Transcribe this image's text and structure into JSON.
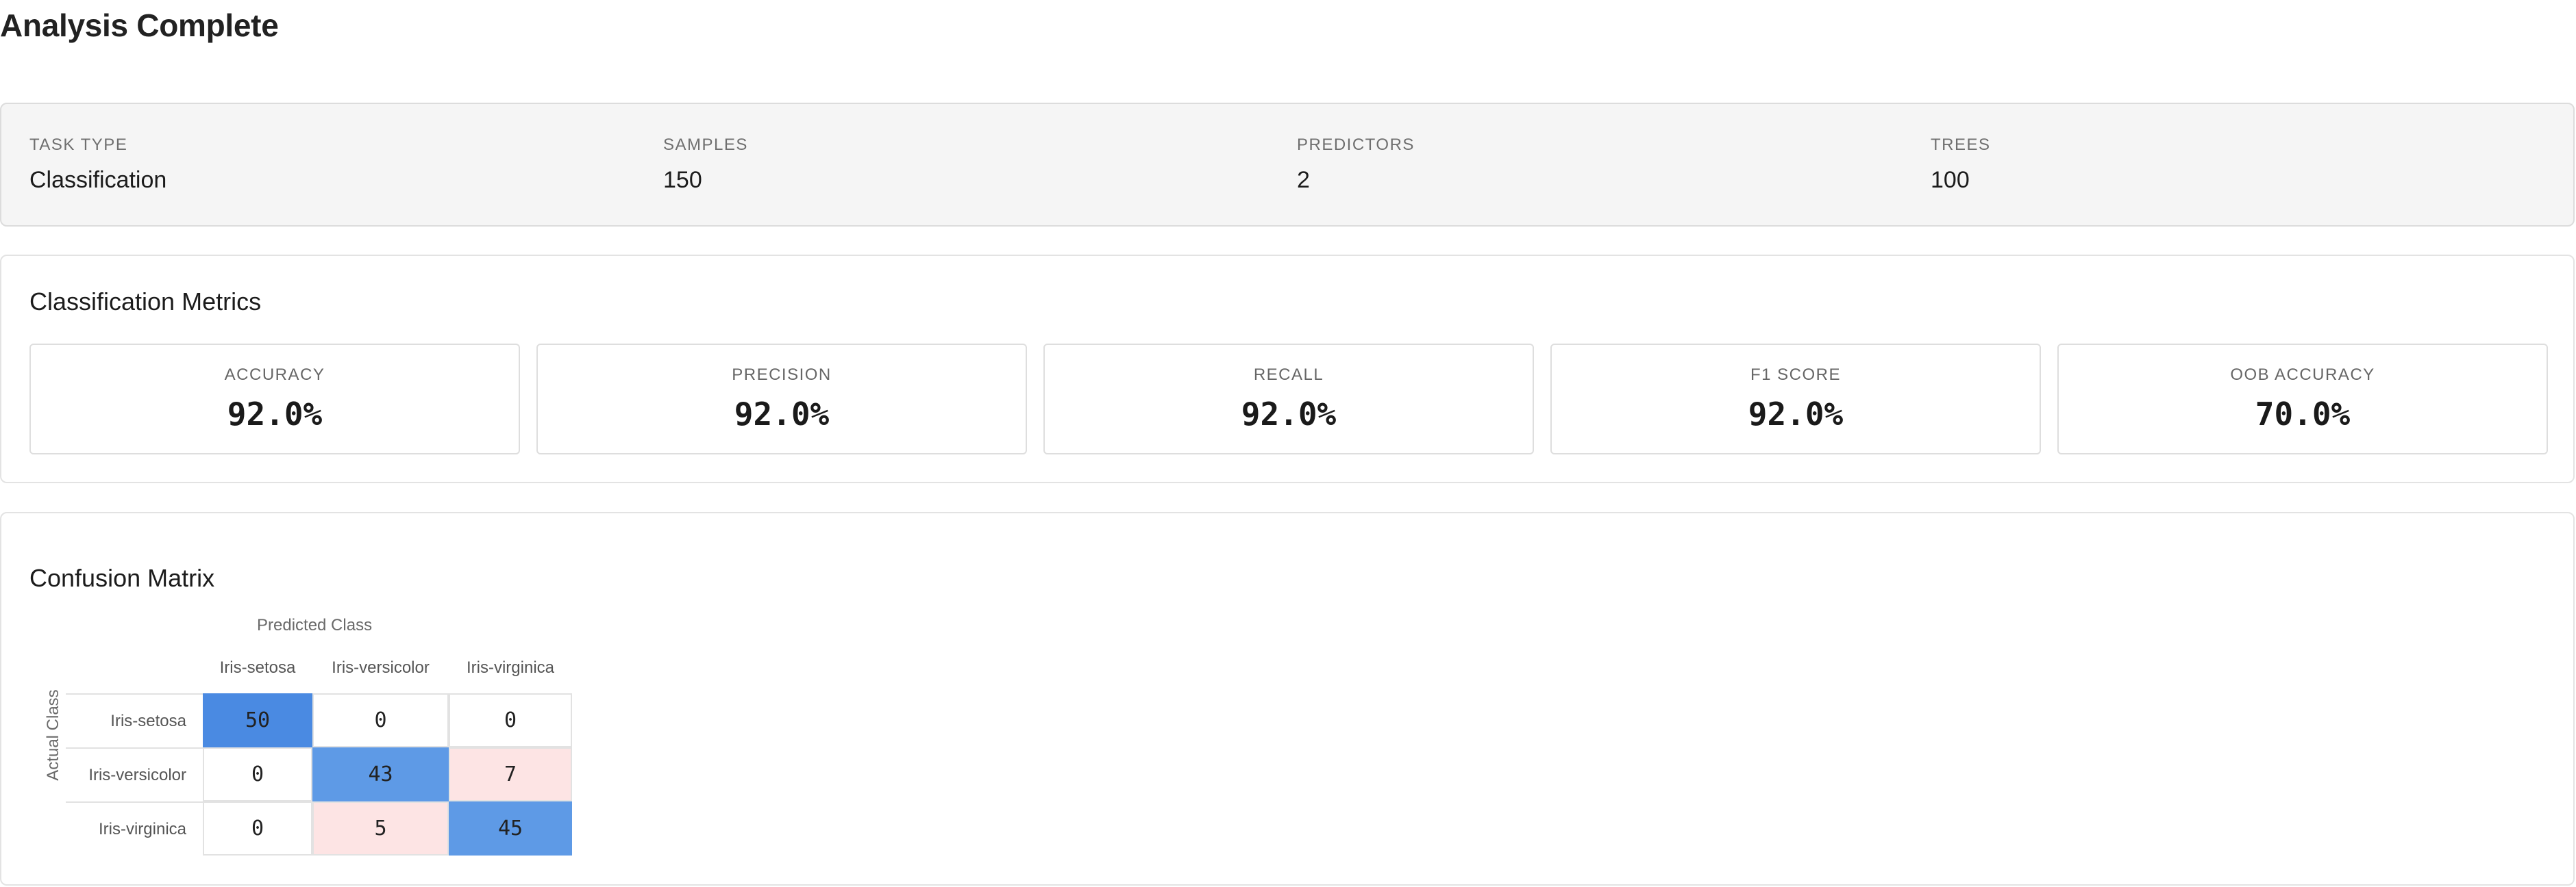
{
  "page": {
    "title": "Analysis Complete"
  },
  "summary": {
    "items": [
      {
        "label": "TASK TYPE",
        "value": "Classification"
      },
      {
        "label": "SAMPLES",
        "value": "150"
      },
      {
        "label": "PREDICTORS",
        "value": "2"
      },
      {
        "label": "TREES",
        "value": "100"
      }
    ]
  },
  "metrics": {
    "title": "Classification Metrics",
    "items": [
      {
        "label": "ACCURACY",
        "value": "92.0%"
      },
      {
        "label": "PRECISION",
        "value": "92.0%"
      },
      {
        "label": "RECALL",
        "value": "92.0%"
      },
      {
        "label": "F1 SCORE",
        "value": "92.0%"
      },
      {
        "label": "OOB ACCURACY",
        "value": "70.0%"
      }
    ]
  },
  "confusion_matrix": {
    "title": "Confusion Matrix",
    "x_axis_label": "Predicted Class",
    "y_axis_label": "Actual Class",
    "classes": [
      "Iris-setosa",
      "Iris-versicolor",
      "Iris-virginica"
    ],
    "values": [
      [
        50,
        0,
        0
      ],
      [
        0,
        43,
        7
      ],
      [
        0,
        5,
        45
      ]
    ]
  },
  "colors": {
    "correct_high": "#4a8ae2",
    "correct_mid": "#5e9ae6",
    "error": "#fde4e4",
    "zero": "#ffffff"
  }
}
